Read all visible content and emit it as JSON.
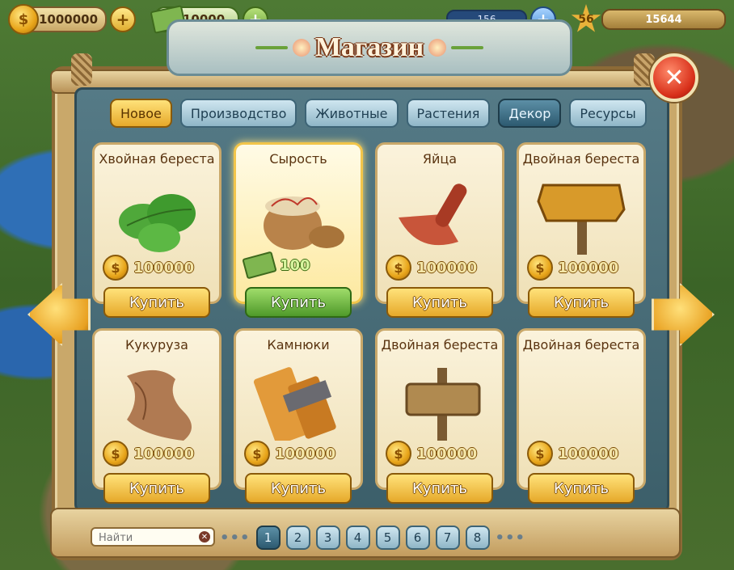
{
  "hud": {
    "coins": "1000000",
    "cash": "10000",
    "energy": "156",
    "level": "56",
    "xp": "15644"
  },
  "window": {
    "title": "Магазин",
    "close_symbol": "✕"
  },
  "tabs": [
    {
      "label": "Новое",
      "state": "new"
    },
    {
      "label": "Производство",
      "state": "normal"
    },
    {
      "label": "Животные",
      "state": "normal"
    },
    {
      "label": "Растения",
      "state": "normal"
    },
    {
      "label": "Декор",
      "state": "selected"
    },
    {
      "label": "Ресурсы",
      "state": "normal"
    }
  ],
  "items": [
    {
      "title": "Хвойная береста",
      "price": "100000",
      "currency": "coin",
      "button": "Купить",
      "icon": "mint-leaves-icon"
    },
    {
      "title": "Сырость",
      "price": "100",
      "currency": "cash",
      "button": "Купить",
      "icon": "bowl-of-sprouts-icon",
      "highlighted": true
    },
    {
      "title": "Яйца",
      "price": "100000",
      "currency": "coin",
      "button": "Купить",
      "icon": "trowel-icon"
    },
    {
      "title": "Двойная береста",
      "price": "100000",
      "currency": "coin",
      "button": "Купить",
      "icon": "gold-sign-icon"
    },
    {
      "title": "Кукуруза",
      "price": "100000",
      "currency": "coin",
      "button": "Купить",
      "icon": "bark-roll-icon"
    },
    {
      "title": "Камнюки",
      "price": "100000",
      "currency": "coin",
      "button": "Купить",
      "icon": "wood-plank-icon"
    },
    {
      "title": "Двойная береста",
      "price": "100000",
      "currency": "coin",
      "button": "Купить",
      "icon": "wooden-gold-sign-icon"
    },
    {
      "title": "Двойная береста",
      "price": "100000",
      "currency": "coin",
      "button": "Купить",
      "icon": "empty"
    }
  ],
  "search": {
    "placeholder": "Найти",
    "clear_symbol": "✕"
  },
  "pagination": {
    "pages": [
      "1",
      "2",
      "3",
      "4",
      "5",
      "6",
      "7",
      "8"
    ],
    "current": "1",
    "ellipsis": "•••"
  },
  "colors": {
    "accent": "#e6a92a",
    "buy_green": "#4f9a2a",
    "panel": "#3c5f6a",
    "close_red": "#d8301a"
  }
}
